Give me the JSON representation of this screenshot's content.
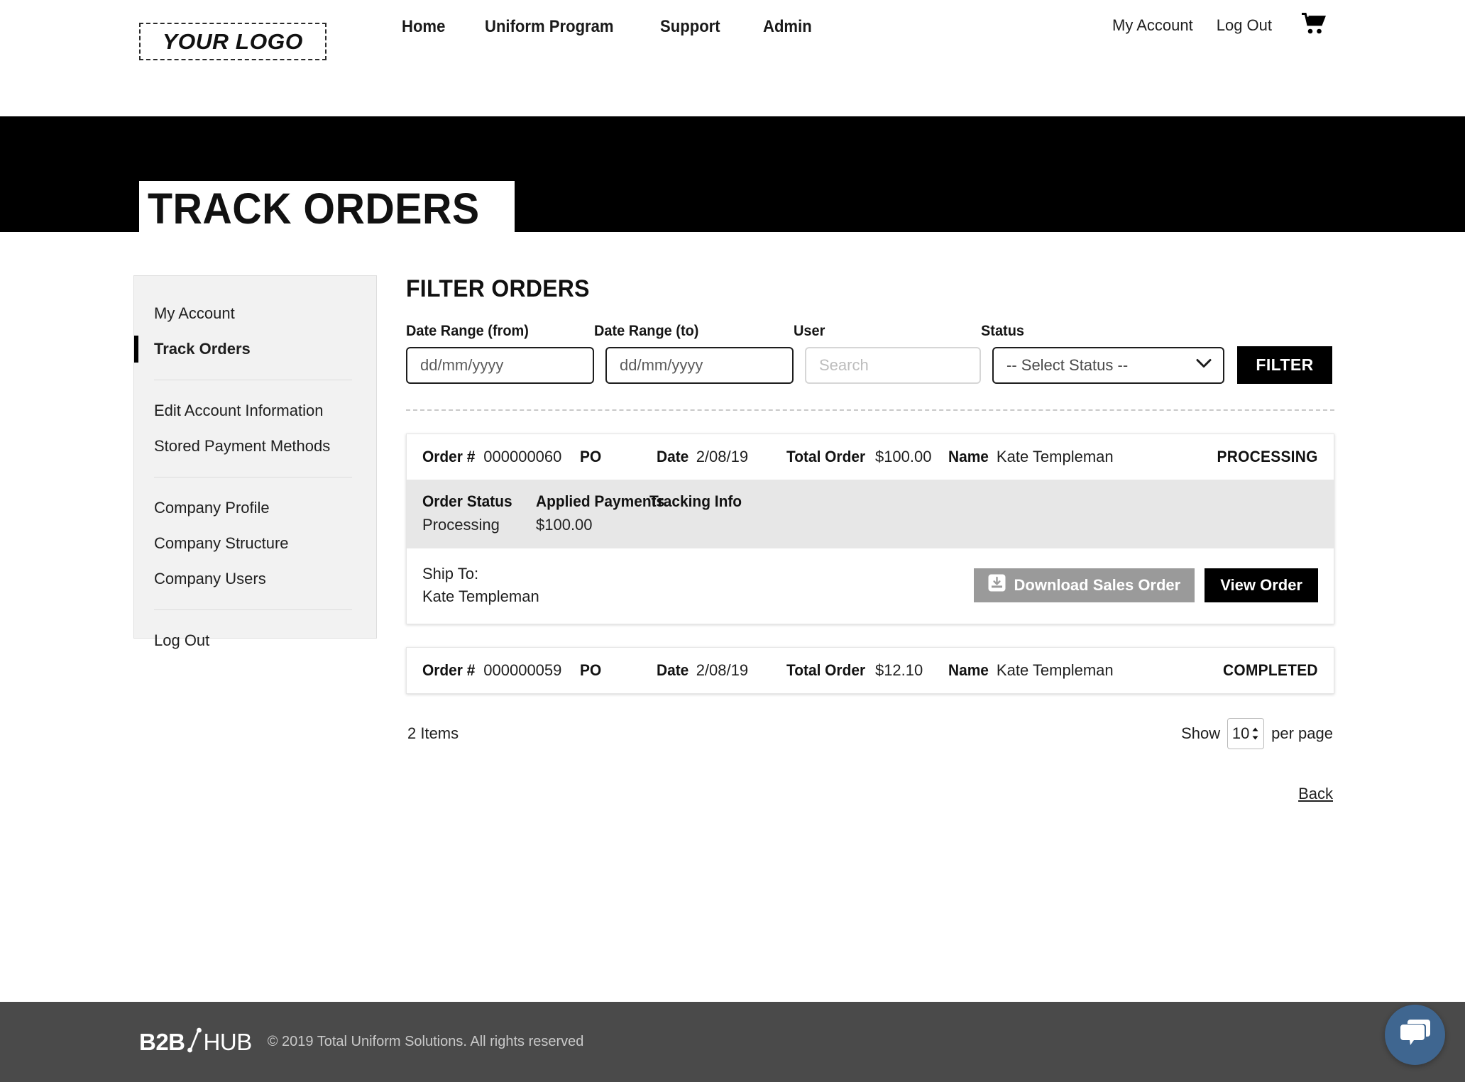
{
  "header": {
    "logo_text": "YOUR LOGO",
    "nav": [
      {
        "label": "Home"
      },
      {
        "label": "Uniform Program"
      },
      {
        "label": "Support"
      },
      {
        "label": "Admin"
      }
    ],
    "util": [
      {
        "label": "My Account"
      },
      {
        "label": "Log Out"
      }
    ],
    "cart_icon": "shopping-cart-icon"
  },
  "page": {
    "title": "TRACK ORDERS"
  },
  "sidebar": {
    "groups": [
      {
        "items": [
          {
            "label": "My Account",
            "active": false
          },
          {
            "label": "Track Orders",
            "active": true
          }
        ]
      },
      {
        "items": [
          {
            "label": "Edit Account Information",
            "active": false
          },
          {
            "label": "Stored Payment Methods",
            "active": false
          }
        ]
      },
      {
        "items": [
          {
            "label": "Company Profile",
            "active": false
          },
          {
            "label": "Company Structure",
            "active": false
          },
          {
            "label": "Company Users",
            "active": false
          }
        ]
      },
      {
        "items": [
          {
            "label": "Log Out",
            "active": false
          }
        ]
      }
    ]
  },
  "filter": {
    "title": "FILTER ORDERS",
    "date_from": {
      "label": "Date Range (from)",
      "placeholder": "dd/mm/yyyy",
      "value": ""
    },
    "date_to": {
      "label": "Date Range (to)",
      "placeholder": "dd/mm/yyyy",
      "value": ""
    },
    "user": {
      "label": "User",
      "placeholder": "Search",
      "value": ""
    },
    "status": {
      "label": "Status",
      "selected": "-- Select Status --"
    },
    "submit_label": "FILTER"
  },
  "orders": [
    {
      "order_key": "Order #",
      "order_value": "000000060",
      "po_key": "PO",
      "po_value": "",
      "date_key": "Date",
      "date_value": "2/08/19",
      "total_key": "Total Order",
      "total_value": "$100.00",
      "name_key": "Name",
      "name_value": "Kate Templeman",
      "status": "PROCESSING",
      "detail": {
        "order_status_head": "Order Status",
        "order_status_value": "Processing",
        "applied_payments_head": "Applied Payments",
        "applied_payments_value": "$100.00",
        "tracking_head": "Tracking Info",
        "tracking_value": ""
      },
      "ship_to_label": "Ship To:",
      "ship_to_name": "Kate Templeman",
      "download_label": "Download Sales Order",
      "view_label": "View Order"
    },
    {
      "order_key": "Order #",
      "order_value": "000000059",
      "po_key": "PO",
      "po_value": "",
      "date_key": "Date",
      "date_value": "2/08/19",
      "total_key": "Total Order",
      "total_value": "$12.10",
      "name_key": "Name",
      "name_value": "Kate Templeman",
      "status": "COMPLETED"
    }
  ],
  "pager": {
    "items_count": "2 Items",
    "show_label": "Show",
    "per_page_value": "10",
    "per_page_label": "per page"
  },
  "back_link": "Back",
  "footer": {
    "logo_bold": "B2B",
    "logo_light": "HUB",
    "copyright": "© 2019 Total Uniform Solutions. All rights reserved"
  },
  "chat": {
    "icon": "chat-bubble-icon"
  },
  "colors": {
    "black": "#000000",
    "sidebar_bg": "#f2f2f2",
    "detail_bg": "#e7e7e7",
    "download_btn": "#9a9a9a",
    "footer_bg": "#4a4a4a",
    "chat_blue": "#3f6690"
  }
}
